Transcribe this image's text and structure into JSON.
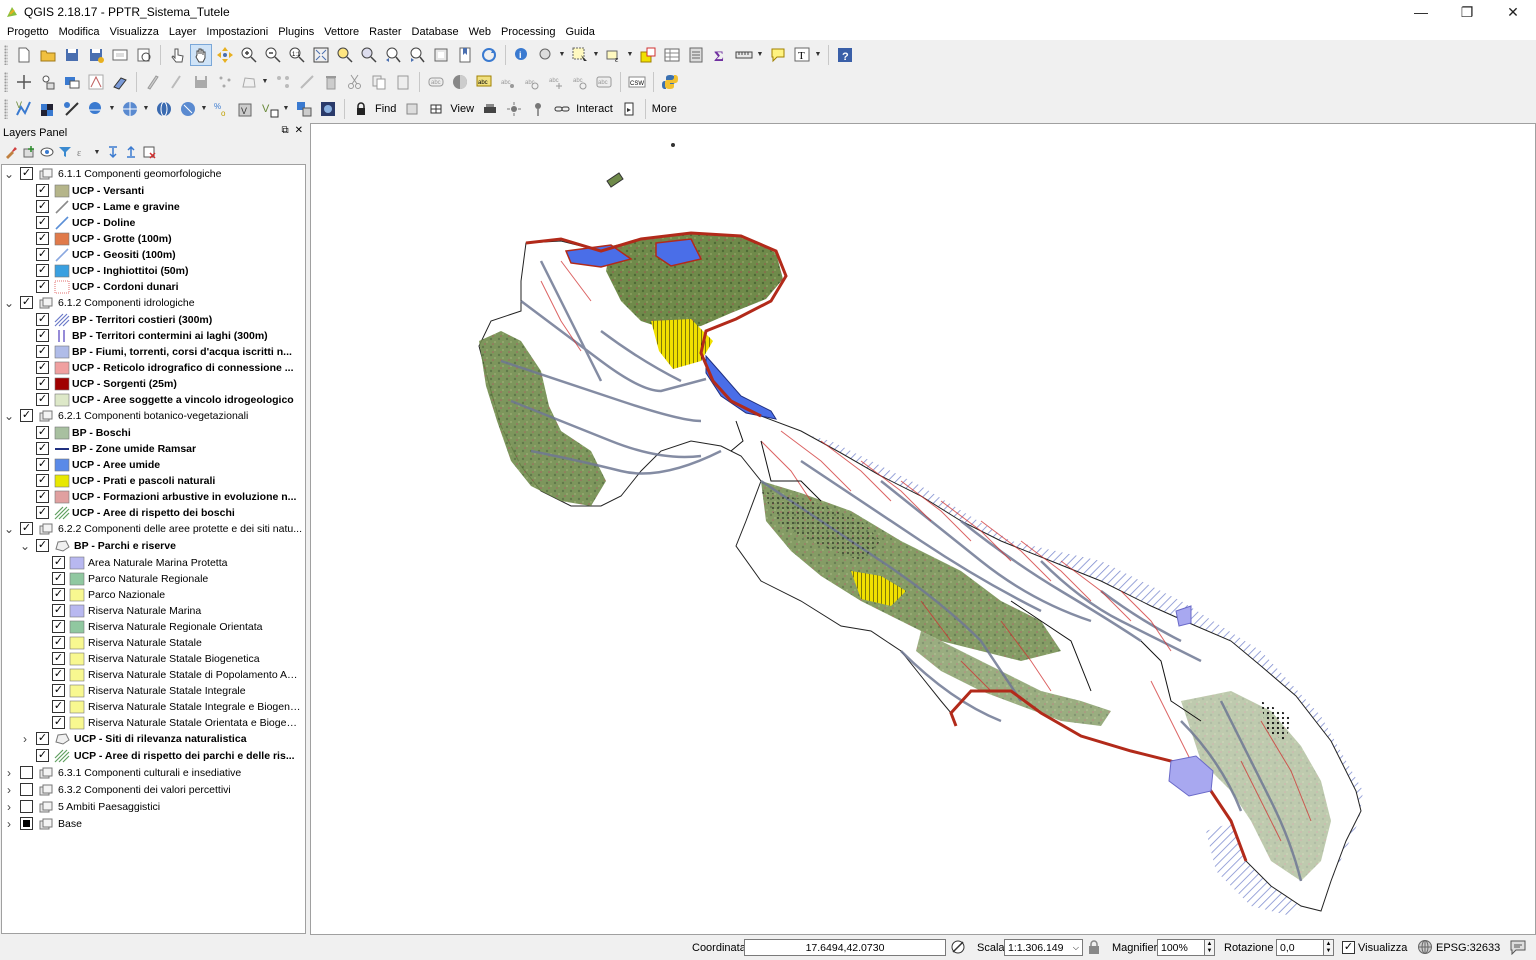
{
  "window": {
    "title": "QGIS 2.18.17 - PPTR_Sistema_Tutele",
    "minimize": "—",
    "restore": "❐",
    "close": "✕"
  },
  "menu": [
    {
      "label": "Progetto"
    },
    {
      "label": "Modifica"
    },
    {
      "label": "Visualizza"
    },
    {
      "label": "Layer"
    },
    {
      "label": "Impostazioni"
    },
    {
      "label": "Plugins"
    },
    {
      "label": "Vettore"
    },
    {
      "label": "Raster"
    },
    {
      "label": "Database"
    },
    {
      "label": "Web"
    },
    {
      "label": "Processing"
    },
    {
      "label": "Guida"
    }
  ],
  "toolbar3": {
    "find": "Find",
    "view": "View",
    "interact": "Interact",
    "more": "More"
  },
  "layers_panel": {
    "title": "Layers Panel",
    "float_btn": "⧉",
    "close_btn": "✕"
  },
  "layers": [
    {
      "label": "6.1.1 Componenti geomorfologiche",
      "type": "group",
      "bold": false,
      "expanded": true,
      "checked": "checked"
    },
    {
      "label": "UCP - Versanti",
      "type": "layer",
      "bold": true,
      "checked": "checked",
      "symbol": "fill",
      "color": "#b5b58a"
    },
    {
      "label": "UCP - Lame e gravine",
      "type": "layer",
      "bold": true,
      "checked": "checked",
      "symbol": "line",
      "color": "#8a8a8a"
    },
    {
      "label": "UCP - Doline",
      "type": "layer",
      "bold": true,
      "checked": "checked",
      "symbol": "line",
      "color": "#5b8fd6"
    },
    {
      "label": "UCP - Grotte (100m)",
      "type": "layer",
      "bold": true,
      "checked": "checked",
      "symbol": "fill",
      "color": "#e07a4a"
    },
    {
      "label": "UCP - Geositi (100m)",
      "type": "layer",
      "bold": true,
      "checked": "checked",
      "symbol": "line",
      "color": "#8aa8e0"
    },
    {
      "label": "UCP - Inghiottitoi (50m)",
      "type": "layer",
      "bold": true,
      "checked": "checked",
      "symbol": "fill",
      "color": "#3aa0e0"
    },
    {
      "label": "UCP - Cordoni dunari",
      "type": "layer",
      "bold": true,
      "checked": "checked",
      "symbol": "dots",
      "color": "#e07070"
    },
    {
      "label": "6.1.2 Componenti idrologiche",
      "type": "group",
      "bold": false,
      "expanded": true,
      "checked": "checked"
    },
    {
      "label": "BP - Territori costieri (300m)",
      "type": "layer",
      "bold": true,
      "checked": "checked",
      "symbol": "hatch",
      "color": "#6a7ac8"
    },
    {
      "label": "BP - Territori contermini ai laghi (300m)",
      "type": "layer",
      "bold": true,
      "checked": "checked",
      "symbol": "vlines",
      "color": "#6a5ac8"
    },
    {
      "label": "BP - Fiumi, torrenti, corsi d'acqua iscritti n...",
      "type": "layer",
      "bold": true,
      "checked": "checked",
      "symbol": "fill",
      "color": "#b0bce8"
    },
    {
      "label": "UCP - Reticolo idrografico di connessione ...",
      "type": "layer",
      "bold": true,
      "checked": "checked",
      "symbol": "fill",
      "color": "#f0a0a0"
    },
    {
      "label": "UCP - Sorgenti (25m)",
      "type": "layer",
      "bold": true,
      "checked": "checked",
      "symbol": "fill",
      "color": "#a00000"
    },
    {
      "label": "UCP - Aree soggette a vincolo idrogeologico",
      "type": "layer",
      "bold": true,
      "checked": "checked",
      "symbol": "fill",
      "color": "#dde8c8"
    },
    {
      "label": "6.2.1 Componenti botanico-vegetazionali",
      "type": "group",
      "bold": false,
      "expanded": true,
      "checked": "checked"
    },
    {
      "label": "BP - Boschi",
      "type": "layer",
      "bold": true,
      "checked": "checked",
      "symbol": "fill",
      "color": "#a8c0a0"
    },
    {
      "label": "BP - Zone umide Ramsar",
      "type": "layer",
      "bold": true,
      "checked": "checked",
      "symbol": "hline",
      "color": "#203080"
    },
    {
      "label": "UCP - Aree umide",
      "type": "layer",
      "bold": true,
      "checked": "checked",
      "symbol": "fill",
      "color": "#5a8ae8"
    },
    {
      "label": "UCP - Prati e pascoli naturali",
      "type": "layer",
      "bold": true,
      "checked": "checked",
      "symbol": "fill",
      "color": "#e8e800"
    },
    {
      "label": "UCP - Formazioni arbustive in evoluzione n...",
      "type": "layer",
      "bold": true,
      "checked": "checked",
      "symbol": "fill",
      "color": "#e0a0a0"
    },
    {
      "label": "UCP - Aree di rispetto dei boschi",
      "type": "layer",
      "bold": true,
      "checked": "checked",
      "symbol": "hatch",
      "color": "#60a060"
    },
    {
      "label": "6.2.2 Componenti delle aree protette e dei siti natu...",
      "type": "group",
      "bold": false,
      "expanded": true,
      "checked": "checked"
    },
    {
      "label": "BP - Parchi e riserve",
      "type": "subgroup",
      "bold": true,
      "expanded": true,
      "checked": "checked"
    },
    {
      "label": "Area Naturale Marina Protetta",
      "type": "class",
      "bold": false,
      "checked": "checked",
      "symbol": "fill",
      "color": "#b8b8f0"
    },
    {
      "label": "Parco Naturale Regionale",
      "type": "class",
      "bold": false,
      "checked": "checked",
      "symbol": "fill",
      "color": "#90c8a0"
    },
    {
      "label": "Parco Nazionale",
      "type": "class",
      "bold": false,
      "checked": "checked",
      "symbol": "fill",
      "color": "#f8f890"
    },
    {
      "label": "Riserva Naturale Marina",
      "type": "class",
      "bold": false,
      "checked": "checked",
      "symbol": "fill",
      "color": "#b8b8f0"
    },
    {
      "label": "Riserva Naturale Regionale Orientata",
      "type": "class",
      "bold": false,
      "checked": "checked",
      "symbol": "fill",
      "color": "#90c8a0"
    },
    {
      "label": "Riserva Naturale Statale",
      "type": "class",
      "bold": false,
      "checked": "checked",
      "symbol": "fill",
      "color": "#f8f890"
    },
    {
      "label": "Riserva Naturale Statale Biogenetica",
      "type": "class",
      "bold": false,
      "checked": "checked",
      "symbol": "fill",
      "color": "#f8f890"
    },
    {
      "label": "Riserva Naturale Statale di Popolamento Ani...",
      "type": "class",
      "bold": false,
      "checked": "checked",
      "symbol": "fill",
      "color": "#f8f890"
    },
    {
      "label": "Riserva Naturale Statale Integrale",
      "type": "class",
      "bold": false,
      "checked": "checked",
      "symbol": "fill",
      "color": "#f8f890"
    },
    {
      "label": "Riserva Naturale Statale Integrale e Biogene...",
      "type": "class",
      "bold": false,
      "checked": "checked",
      "symbol": "fill",
      "color": "#f8f890"
    },
    {
      "label": "Riserva Naturale Statale Orientata e Biogene...",
      "type": "class",
      "bold": false,
      "checked": "checked",
      "symbol": "fill",
      "color": "#f8f890"
    },
    {
      "label": "UCP - Siti di rilevanza naturalistica",
      "type": "subgroup",
      "bold": true,
      "expanded": false,
      "checked": "checked"
    },
    {
      "label": "UCP - Aree di rispetto dei parchi e delle ris...",
      "type": "layer2",
      "bold": true,
      "checked": "checked",
      "symbol": "hatch",
      "color": "#60a060"
    },
    {
      "label": "6.3.1 Componenti culturali e insediative",
      "type": "group",
      "bold": false,
      "expanded": false,
      "checked": "unchecked"
    },
    {
      "label": "6.3.2 Componenti dei valori percettivi",
      "type": "group",
      "bold": false,
      "expanded": false,
      "checked": "unchecked"
    },
    {
      "label": "5 Ambiti Paesaggistici",
      "type": "group",
      "bold": false,
      "expanded": false,
      "checked": "unchecked"
    },
    {
      "label": "Base",
      "type": "group",
      "bold": false,
      "expanded": false,
      "checked": "partial"
    }
  ],
  "status": {
    "coord_label": "Coordinata",
    "coord_value": "17.6494,42.0730",
    "scale_label": "Scala",
    "scale_value": "1:1.306.149",
    "magnifier_label": "Magnifier",
    "magnifier_value": "100%",
    "rotation_label": "Rotazione",
    "rotation_value": "0,0",
    "render_label": "Visualizza",
    "crs": "EPSG:32633"
  },
  "colors": {
    "coast_red": "#b22a1a",
    "woods_green": "#6f8a4a",
    "rivers_blue": "#6f7894",
    "hydro_red": "#d03030",
    "wetland_blue": "#4a6ee8",
    "yellow": "#f0e000",
    "marine_area": "#a8a8f0"
  }
}
